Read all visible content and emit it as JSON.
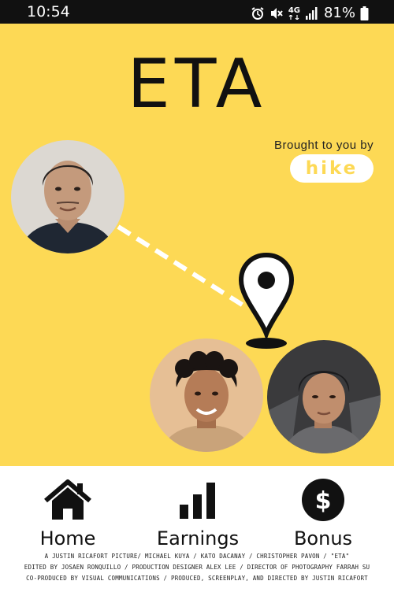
{
  "status_bar": {
    "time": "10:54",
    "network": "4G",
    "battery": "81%",
    "icons": [
      "alarm-icon",
      "mute-icon",
      "network-4g-icon",
      "signal-icon",
      "battery-icon"
    ]
  },
  "poster": {
    "title": "ETA",
    "sponsor_text": "Brought to you by",
    "sponsor_logo": "hike",
    "colors": {
      "background": "#fdd955",
      "text": "#111111",
      "line": "#ffffff"
    }
  },
  "nav": {
    "items": [
      {
        "label": "Home",
        "icon": "home-icon"
      },
      {
        "label": "Earnings",
        "icon": "bar-chart-icon"
      },
      {
        "label": "Bonus",
        "icon": "dollar-icon"
      }
    ]
  },
  "credits": {
    "lines": [
      "A Justin Ricafort Picture/ Michael Kuya / Kato Dacanay / Christopher Pavon / \"ETA\"",
      "Edited by Josaen Ronquillo / Production Designer Alex Lee / Director of Photography Farrah Su",
      "Co-produced by Visual Communications / Produced, Screenplay, and Directed by Justin Ricafort"
    ]
  }
}
